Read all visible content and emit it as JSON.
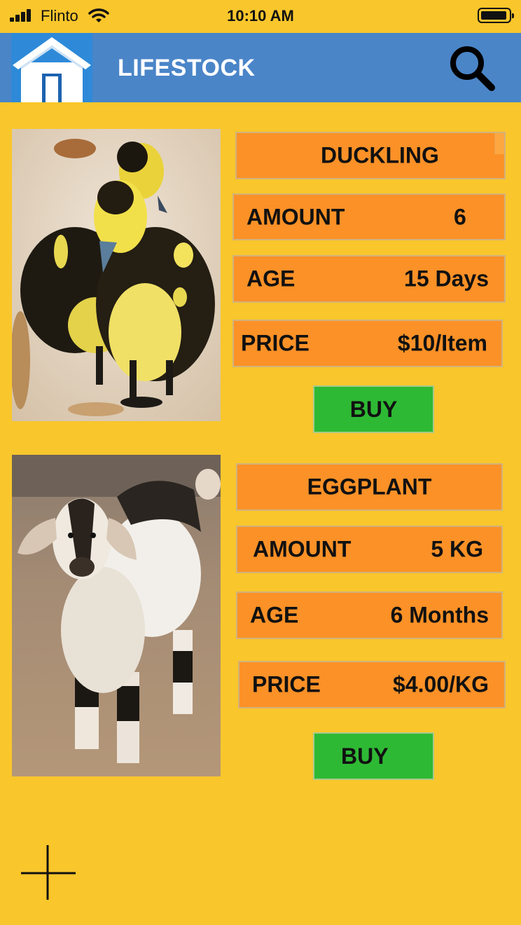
{
  "status_bar": {
    "carrier": "Flinto",
    "time": "10:10 AM",
    "icons": [
      "signal-bars-icon",
      "wifi-icon",
      "battery-icon"
    ]
  },
  "header": {
    "title": "LIFESTOCK",
    "home_icon": "home-icon",
    "search_icon": "search-icon",
    "background": "#4a85c8"
  },
  "products": [
    {
      "image": "ducklings-photo",
      "name": "DUCKLING",
      "amount_label": "AMOUNT",
      "amount_value": "6",
      "age_label": "AGE",
      "age_value": "15 Days",
      "price_label": "PRICE",
      "price_value": "$10/Item",
      "buy_label": "BUY"
    },
    {
      "image": "goat-kid-photo",
      "name": "EGGPLANT",
      "amount_label": "AMOUNT",
      "amount_value": "5 KG",
      "age_label": "AGE",
      "age_value": "6 Months",
      "price_label": "PRICE",
      "price_value": "$4.00/KG",
      "buy_label": "BUY"
    }
  ],
  "add_icon": "plus-icon",
  "colors": {
    "background": "#f9c62c",
    "field": "#fb9127",
    "buy": "#2eb934",
    "header": "#4a85c8"
  }
}
